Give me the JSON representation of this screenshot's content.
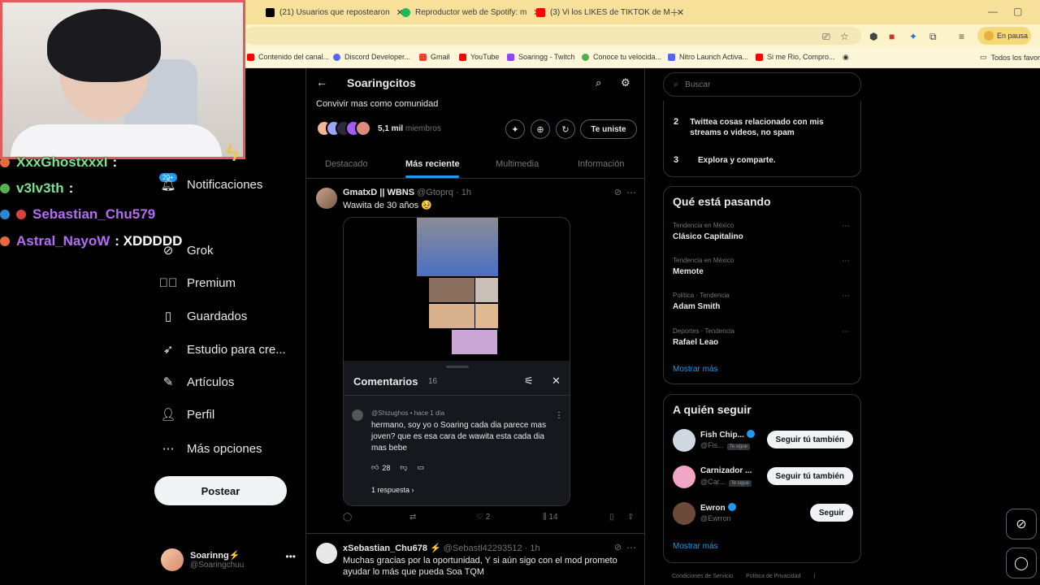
{
  "browser": {
    "tabs": [
      {
        "title": "(21) Usuarios que repostearon",
        "icon": "x-logo-icon",
        "color": "#000000"
      },
      {
        "title": "Reproductor web de Spotify: m",
        "icon": "spotify-icon",
        "color": "#1db954"
      },
      {
        "title": "(3) Vi los LIKES de TIKTOK de M",
        "icon": "youtube-icon",
        "color": "#ff0000"
      }
    ],
    "paused_label": "En pausa",
    "bookmarks": [
      {
        "label": "Contenido del canal...",
        "color": "#ff0000"
      },
      {
        "label": "Discord Developer...",
        "color": "#5865f2"
      },
      {
        "label": "Gmail",
        "color": "#ea4335"
      },
      {
        "label": "YouTube",
        "color": "#ff0000"
      },
      {
        "label": "Soaringg - Twitch",
        "color": "#9146ff"
      },
      {
        "label": "Conoce tu velocida...",
        "color": "#4caf50"
      },
      {
        "label": "Nitro Launch Activa...",
        "color": "#5865f2"
      },
      {
        "label": "Si me Rio, Compro...",
        "color": "#ff0000"
      }
    ],
    "bookmarks_folder": "Todos los favori"
  },
  "stream_chat": [
    {
      "user": "XxxGhostxxxI",
      "msg": ":",
      "color": "#7be38f",
      "badge": "#e86a3a"
    },
    {
      "user": "v3lv3th",
      "msg": ":",
      "color": "#7be38f",
      "badge": "#53b24b"
    },
    {
      "user": "Sebastian_Chu579",
      "msg": "",
      "color": "#b36cf5",
      "badge": "#2f86d6"
    },
    {
      "user": "Astral_NayoW",
      "msg": ": XDDDDD",
      "color": "#b36cf5",
      "badge": "#e86a3a"
    }
  ],
  "nav": {
    "notifications_badge": "20+",
    "items": [
      {
        "label": "Notificaciones",
        "icon": "bell-icon"
      },
      {
        "label": "Grok",
        "icon": "grok-icon"
      },
      {
        "label": "Premium",
        "icon": "verified-icon"
      },
      {
        "label": "Guardados",
        "icon": "bookmark-icon"
      },
      {
        "label": "Estudio para cre...",
        "icon": "rocket-icon"
      },
      {
        "label": "Artículos",
        "icon": "article-icon"
      },
      {
        "label": "Perfil",
        "icon": "person-icon"
      },
      {
        "label": "Más opciones",
        "icon": "more-circle-icon"
      }
    ],
    "post_label": "Postear",
    "account": {
      "name": "Soarinng⚡",
      "handle": "@Soaringchuu"
    }
  },
  "community": {
    "title": "Soaringcitos",
    "description": "Convivir mas como comunidad",
    "members_count": "5,1 mil",
    "members_label": "miembros",
    "join_label": "Te uniste",
    "tabs": [
      "Destacado",
      "Más reciente",
      "Multimedia",
      "Información"
    ],
    "active_tab": "Más reciente"
  },
  "posts": [
    {
      "name": "GmatxD || WBNS",
      "handle": "@Gtoprq",
      "time": "1h",
      "text": "Wawita de 30 años 🥹",
      "media": {
        "comments_title": "Comentarios",
        "comments_count": "16",
        "comment_user": "@Shizughos • hace 1 día",
        "comment_text": "hermano, soy yo o Soaring cada dia parece mas joven? que es esa cara de wawita esta cada dia mas bebe",
        "comment_likes": "28",
        "replies": "1 respuesta"
      },
      "retweets": "",
      "likes": "2",
      "views": "14"
    },
    {
      "name": "xSebastian_Chu678 ⚡",
      "handle": "@Sebastl42293512",
      "time": "1h",
      "text": "Muchas gracias por la oportunidad, Y si aún sigo con el mod prometo ayudar lo más que pueda  Soa TQM"
    }
  ],
  "right": {
    "search_placeholder": "Buscar",
    "rules": [
      {
        "num": "2",
        "text": "Twittea cosas relacionado con mis streams o videos, no spam"
      },
      {
        "num": "3",
        "text": "Explora y comparte."
      }
    ],
    "trends_title": "Qué está pasando",
    "trends": [
      {
        "context": "Tendencia en México",
        "name": "Clásico Capitalino"
      },
      {
        "context": "Tendencia en México",
        "name": "Memote"
      },
      {
        "context": "Política · Tendencia",
        "name": "Adam Smith"
      },
      {
        "context": "Deportes · Tendencia",
        "name": "Rafael Leao"
      }
    ],
    "show_more": "Mostrar más",
    "follow_title": "A quién seguir",
    "follow": [
      {
        "name": "Fish Chip...",
        "handle": "@Fis...",
        "tag": "Te sigue",
        "button": "Seguir tú también",
        "color": "#cfd8e3"
      },
      {
        "name": "Carnizador ...",
        "handle": "@Car...",
        "tag": "Te sigue",
        "button": "Seguir tú también",
        "color": "#f0a6c4"
      },
      {
        "name": "Ewron",
        "handle": "@Ewrron",
        "tag": "",
        "button": "Seguir",
        "color": "#6b4a3a"
      }
    ],
    "footer": [
      "Condiciones de Servicio",
      "Política de Privacidad",
      "|"
    ]
  }
}
